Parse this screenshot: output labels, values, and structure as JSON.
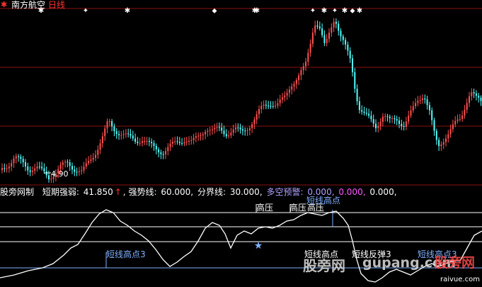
{
  "header": {
    "stock_name": "南方航空",
    "period": "日线",
    "colors": {
      "stock_name": "#ffffff",
      "period": "#ff3333",
      "logo": "#ff3333"
    }
  },
  "price_panel": {
    "low_label": "4.90",
    "colors": {
      "up_candle": "#ff5050",
      "down_candle": "#54ffff",
      "grid": "#8b1010",
      "marker": "#ffffff"
    }
  },
  "indicator_bar": {
    "name": "股旁网制",
    "short_label": "短期强弱:",
    "short_value": "41.850",
    "short_arrow": "↑",
    "strong_label": "强势线:",
    "strong_value": "60.000,",
    "boundary_label": "分界线:",
    "boundary_value": "30.000,",
    "warn_label": "多空预警:",
    "warn_v1": "0.000,",
    "warn_v2": "0.000,",
    "warn_v3": "0.000,",
    "colors": {
      "name": "#ffffff",
      "warn_label": "#b0a0ff",
      "warn_v2": "#ff55ff",
      "arrow": "#ff3333"
    }
  },
  "annotations": {
    "high_press_1": "高压",
    "high_press_2": "高压",
    "high_press_3": "高压",
    "short_high_top": "短线高点",
    "short_high_left": "短线高点3",
    "short_high_mid": "短线高点",
    "short_rebound": "短线反弹3",
    "short_high_right": "短线高点3",
    "colors": {
      "white": "#ffffff",
      "blue": "#7fb0ff"
    }
  },
  "watermarks": {
    "left": "股旁网",
    "mid": "gupang.com",
    "right_logo": "股旁网",
    "right_small": "raivue.com"
  }
}
